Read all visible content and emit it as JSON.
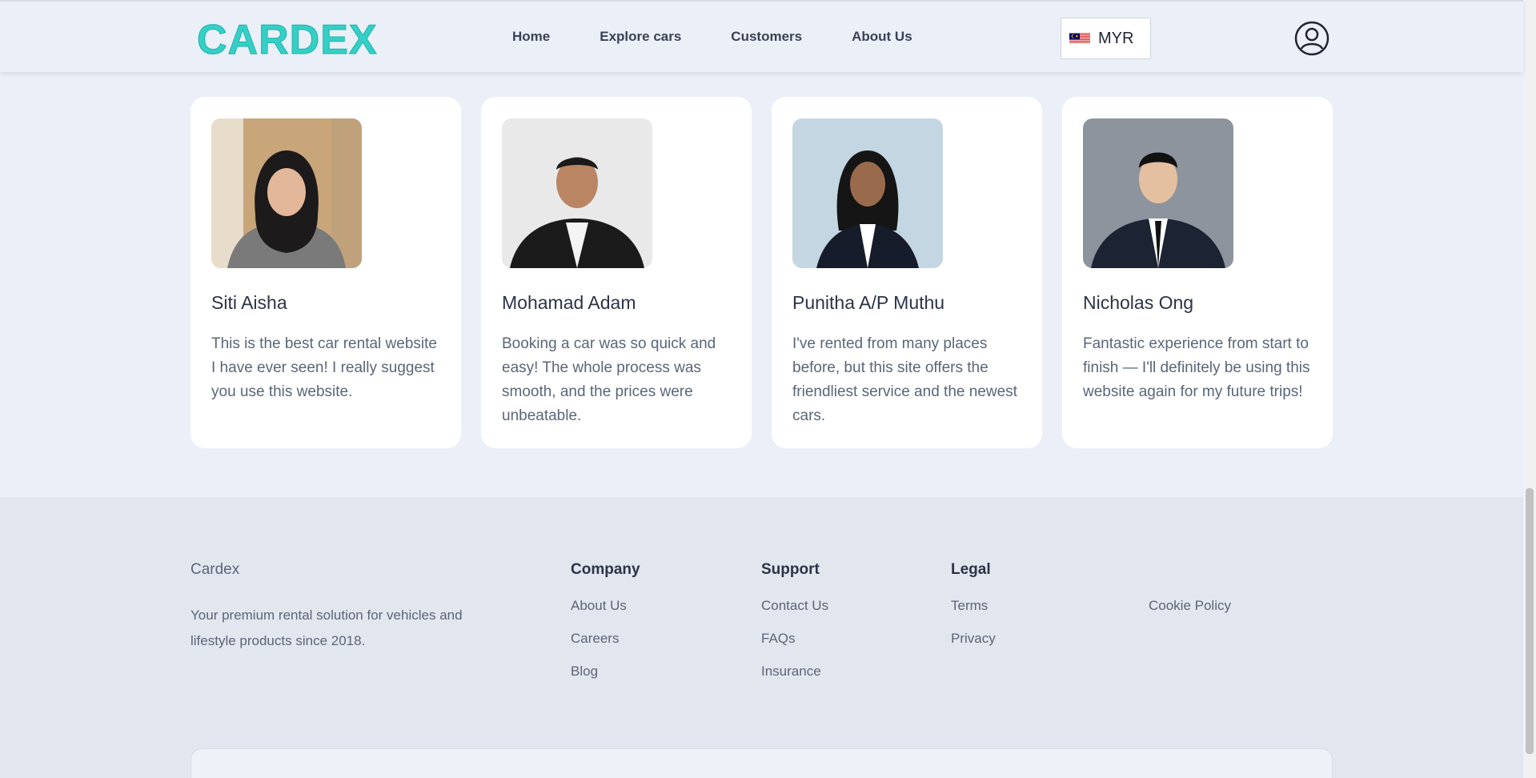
{
  "header": {
    "logo": "CARDEX",
    "nav": [
      {
        "label": "Home"
      },
      {
        "label": "Explore cars"
      },
      {
        "label": "Customers"
      },
      {
        "label": "About Us"
      }
    ],
    "currency": "MYR"
  },
  "testimonials": [
    {
      "name": "Siti Aisha",
      "text": "This is the best car rental website I have ever seen! I really suggest you use this website."
    },
    {
      "name": "Mohamad Adam",
      "text": "Booking a car was so quick and easy! The whole process was smooth, and the prices were unbeatable."
    },
    {
      "name": "Punitha A/P Muthu",
      "text": "I've rented from many places before, but this site offers the friendliest service and the newest cars."
    },
    {
      "name": "Nicholas Ong",
      "text": "Fantastic experience from start to finish — I'll definitely be using this website again for my future trips!"
    }
  ],
  "footer": {
    "brand": "Cardex",
    "tagline": "Your premium rental solution for vehicles and lifestyle products since 2018.",
    "company": {
      "heading": "Company",
      "links": [
        "About Us",
        "Careers",
        "Blog"
      ]
    },
    "support": {
      "heading": "Support",
      "links": [
        "Contact Us",
        "FAQs",
        "Insurance"
      ]
    },
    "legal": {
      "heading": "Legal",
      "links": [
        "Terms",
        "Privacy"
      ]
    },
    "extra": {
      "links": [
        "Cookie Policy"
      ]
    }
  },
  "colors": {
    "brand": "#35cfc6",
    "background": "#ebeff7",
    "footer": "#e2e6ee"
  }
}
